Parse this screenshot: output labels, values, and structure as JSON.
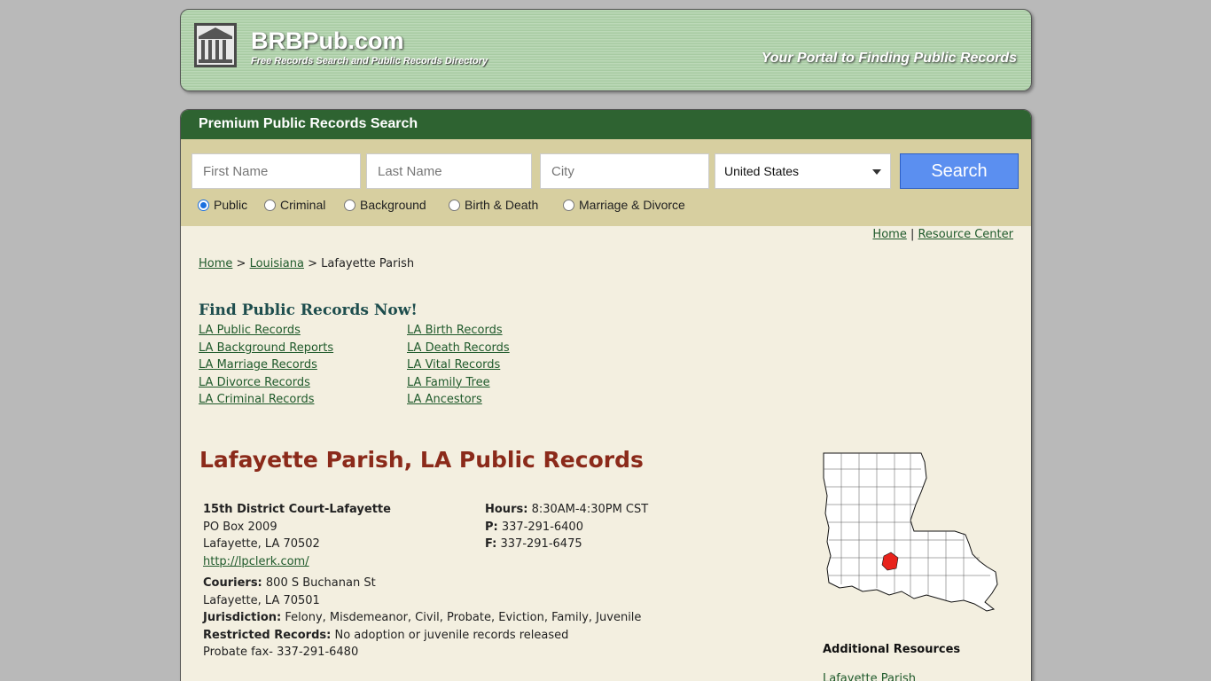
{
  "header": {
    "site_name": "BRBPub.com",
    "tagline": "Free Records Search and Public Records Directory",
    "portal_text": "Your Portal to Finding Public Records"
  },
  "search": {
    "panel_title": "Premium Public Records Search",
    "first_name_placeholder": "First Name",
    "last_name_placeholder": "Last Name",
    "city_placeholder": "City",
    "country_value": "United States",
    "search_label": "Search",
    "radio_options": [
      "Public",
      "Criminal",
      "Background",
      "Birth & Death",
      "Marriage & Divorce"
    ],
    "radio_selected": "Public"
  },
  "toplinks": {
    "home": "Home",
    "separator": "|",
    "resource_center": "Resource Center"
  },
  "breadcrumb": {
    "home": "Home",
    "sep": ">",
    "state": "Louisiana",
    "current": "Lafayette Parish"
  },
  "find": {
    "title": "Find Public Records Now!",
    "left": [
      "LA Public Records",
      "LA Background Reports",
      "LA Marriage Records",
      "LA Divorce Records",
      "LA Criminal Records"
    ],
    "right": [
      "LA Birth Records",
      "LA Death Records",
      "LA Vital Records",
      "LA Family Tree",
      "LA Ancestors"
    ]
  },
  "page_title": "Lafayette Parish, LA Public Records",
  "office": {
    "name": "15th District Court-Lafayette",
    "address1": "PO Box 2009",
    "address2": "Lafayette, LA 70502",
    "website": "http://lpclerk.com/",
    "hours_label": "Hours:",
    "hours": "8:30AM-4:30PM CST",
    "phone_label": "P:",
    "phone": "337-291-6400",
    "fax_label": "F:",
    "fax": "337-291-6475",
    "couriers_label": "Couriers:",
    "couriers1": "800 S Buchanan St",
    "couriers2": "Lafayette, LA 70501",
    "jurisdiction_label": "Jurisdiction:",
    "jurisdiction": "Felony, Misdemeanor, Civil, Probate, Eviction, Family, Juvenile",
    "restricted_label": "Restricted Records:",
    "restricted": "No adoption or juvenile records released",
    "probate_fax": "Probate fax- 337-291-6480"
  },
  "sidebar": {
    "additional_title": "Additional Resources",
    "first_link": "Lafayette Parish"
  },
  "colors": {
    "header_green": "#2e6331",
    "title_red": "#8b2a1a",
    "search_blue": "#5b8ff0",
    "highlight_red": "#e8231c"
  }
}
